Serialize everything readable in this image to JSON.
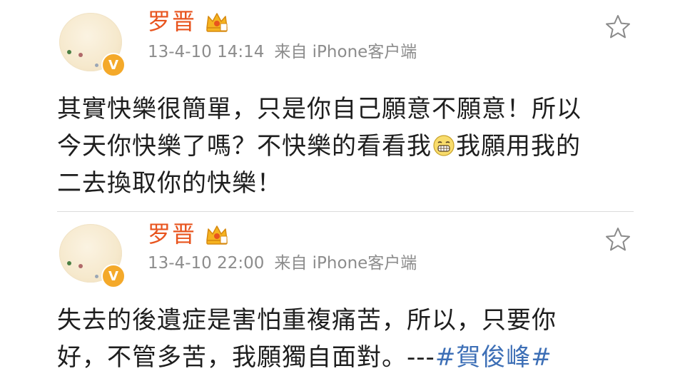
{
  "posts": [
    {
      "username": "罗晋",
      "time": "13-4-10 14:14",
      "source": "来自 iPhone客户端",
      "text_line1": "其實快樂很簡單，只是你自己願意不願意！所以",
      "text_line2_a": "今天你快樂了嗎？不快樂的看看我",
      "text_line2_b": "我願用我的",
      "text_line3": "二去換取你的快樂！",
      "emoji_icon": "grin-emoji"
    },
    {
      "username": "罗晋",
      "time": "13-4-10 22:00",
      "source": "来自 iPhone客户端",
      "text_line1": "失去的後遺症是害怕重複痛苦，所以，只要你",
      "text_line2": "好，不管多苦，我願獨自面對。---",
      "hashtag": "#賀俊峰#"
    }
  ],
  "colors": {
    "username": "#e8541e",
    "meta": "#8c8c8c",
    "hashtag": "#3d6fb6",
    "badge": "#f4a92a"
  },
  "icons": {
    "verified": "verified-v-icon",
    "crown": "crown-icon",
    "favorite": "star-icon"
  },
  "badge_letter": "V"
}
